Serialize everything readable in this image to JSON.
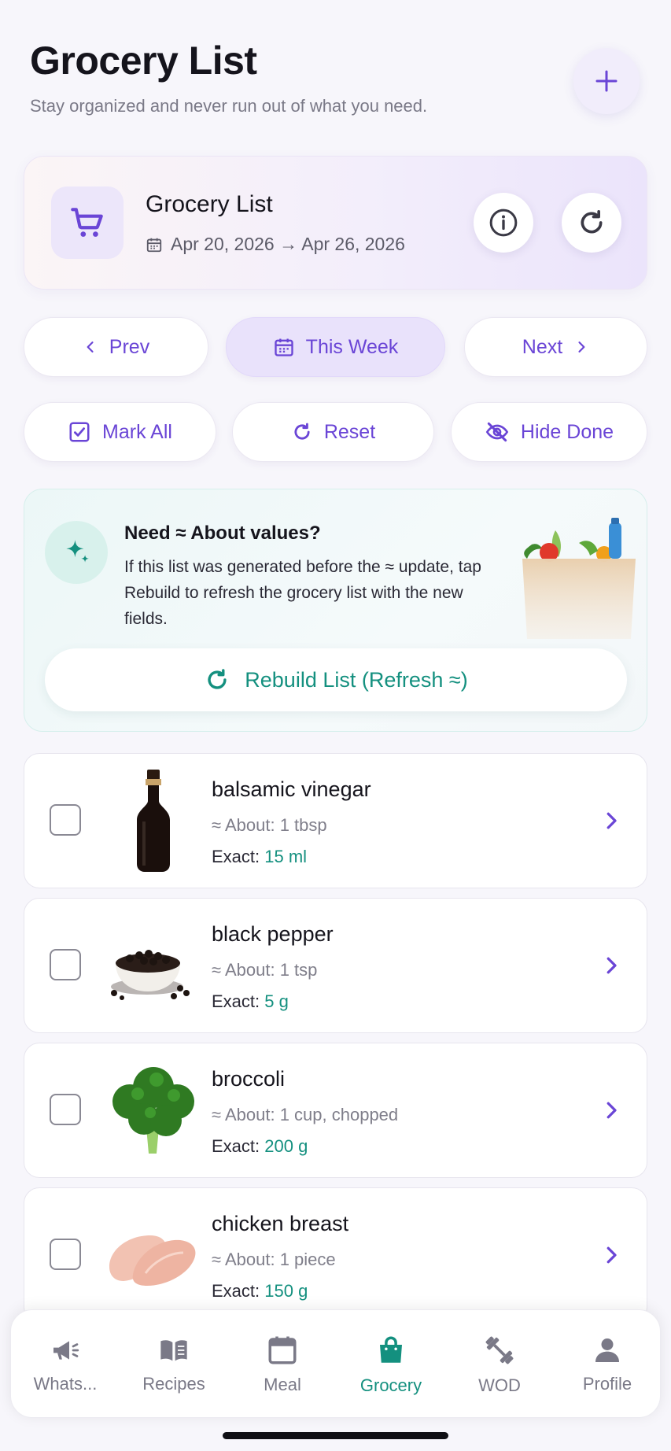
{
  "header": {
    "title": "Grocery List",
    "subtitle": "Stay organized and never run out of what you need.",
    "add_icon": "plus-icon"
  },
  "summary": {
    "title": "Grocery List",
    "date_range": "Apr 20, 2026 → Apr 26, 2026",
    "icons": [
      "cart-icon",
      "calendar-icon",
      "info-icon",
      "refresh-icon"
    ]
  },
  "week_nav": {
    "prev": "Prev",
    "this_week": "This Week",
    "next": "Next"
  },
  "actions": {
    "mark_all": "Mark All",
    "reset": "Reset",
    "hide_done": "Hide Done"
  },
  "info": {
    "title": "Need ≈ About values?",
    "text": "If this list was generated before the ≈ update, tap Rebuild to refresh the grocery list with the new fields.",
    "button": "Rebuild List (Refresh ≈)"
  },
  "items": [
    {
      "name": "balsamic vinegar",
      "about": "≈ About: 1 tbsp",
      "exact_label": "Exact:",
      "exact_value": "15 ml",
      "checked": false
    },
    {
      "name": "black pepper",
      "about": "≈ About: 1 tsp",
      "exact_label": "Exact:",
      "exact_value": "5 g",
      "checked": false
    },
    {
      "name": "broccoli",
      "about": "≈ About: 1 cup, chopped",
      "exact_label": "Exact:",
      "exact_value": "200 g",
      "checked": false
    },
    {
      "name": "chicken breast",
      "about": "≈ About: 1 piece",
      "exact_label": "Exact:",
      "exact_value": "150 g",
      "checked": false
    }
  ],
  "tabs": [
    {
      "label": "Whats...",
      "icon": "megaphone-icon",
      "active": false
    },
    {
      "label": "Recipes",
      "icon": "book-icon",
      "active": false
    },
    {
      "label": "Meal",
      "icon": "calendar-icon",
      "active": false
    },
    {
      "label": "Grocery",
      "icon": "shopping-bag-icon",
      "active": true
    },
    {
      "label": "WOD",
      "icon": "dumbbell-icon",
      "active": false
    },
    {
      "label": "Profile",
      "icon": "person-icon",
      "active": false
    }
  ],
  "colors": {
    "accent_purple": "#6a45d6",
    "accent_teal": "#14907f",
    "background": "#f7f6fb"
  }
}
